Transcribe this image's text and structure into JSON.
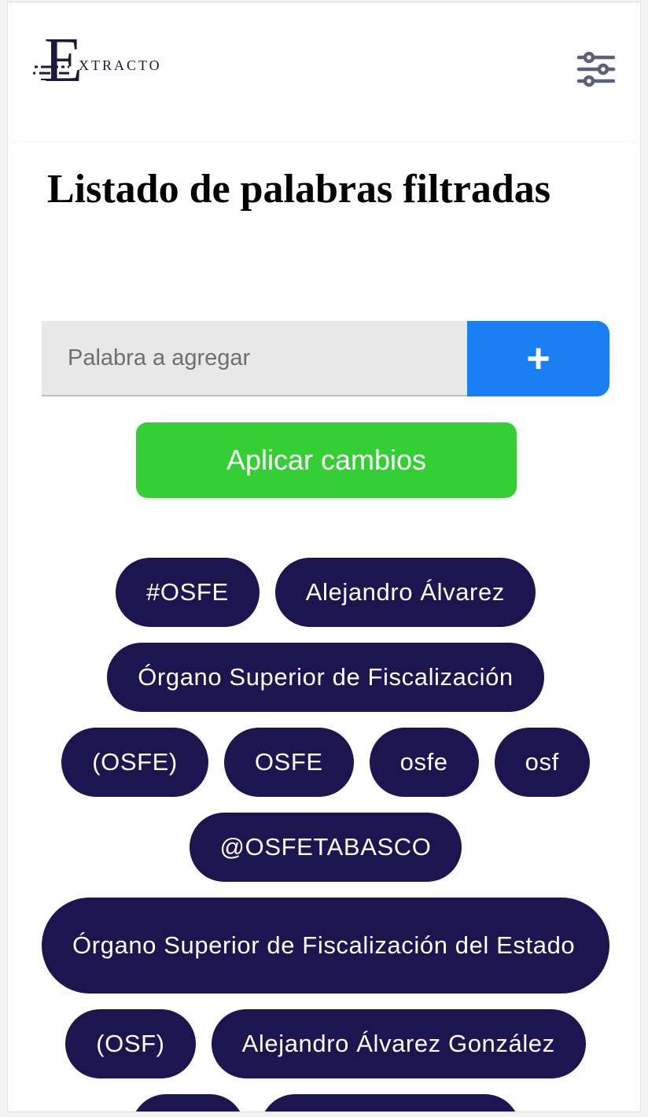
{
  "app": {
    "logo_text": "XTRACTO",
    "logo_letter": "E"
  },
  "header": {
    "settings_icon": "sliders-icon"
  },
  "page": {
    "title": "Listado de palabras filtradas"
  },
  "add_word": {
    "placeholder": "Palabra a agregar",
    "value": "",
    "button_label": "+"
  },
  "apply": {
    "label": "Aplicar cambios"
  },
  "words": [
    "#OSFE",
    "Alejandro Álvarez",
    "Órgano Superior de Fiscalización",
    "(OSFE)",
    "OSFE",
    "osfe",
    "osf",
    "@OSFETABASCO",
    "Órgano Superior de Fiscalización del Estado",
    "(OSF)",
    "Alejandro Álvarez González"
  ],
  "colors": {
    "brand": "#1b1a3d",
    "chip_bg": "#1c1550",
    "add_button": "#1a7ef5",
    "apply_button": "#34cf34",
    "input_bg": "#e8e8e8"
  }
}
